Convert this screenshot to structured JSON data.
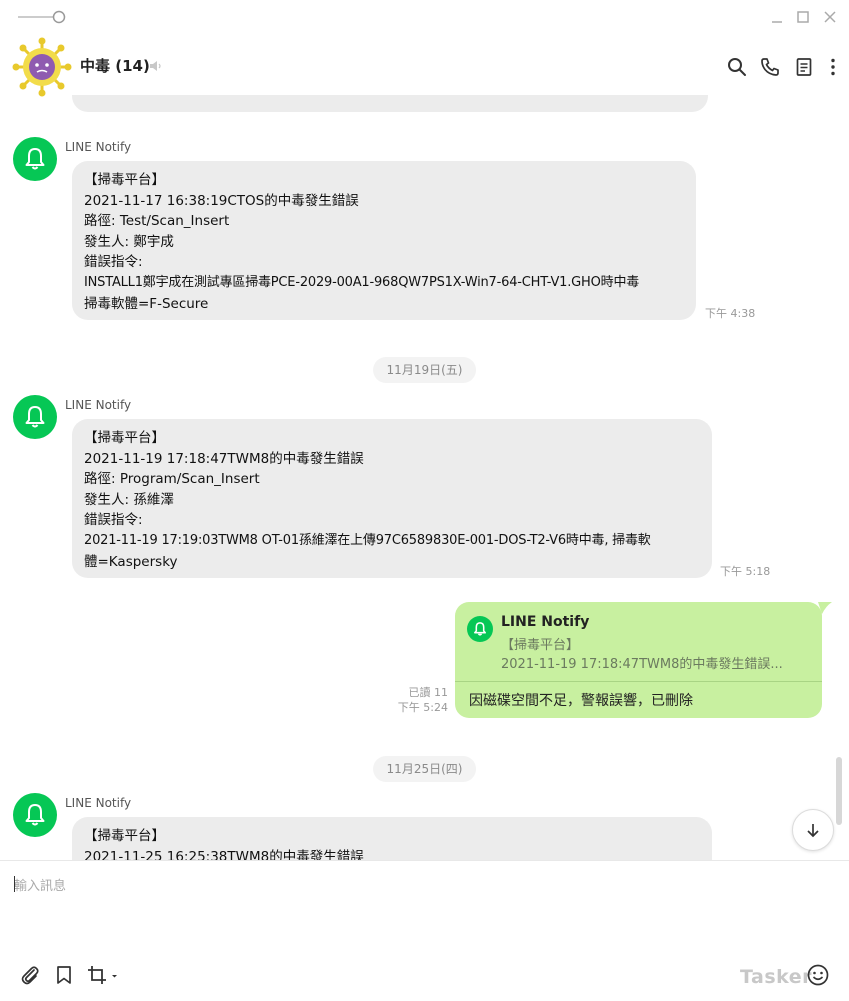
{
  "header": {
    "chat_name": "中毒",
    "member_count": "(14)"
  },
  "icons": {
    "slider": "slider-icon",
    "minimize": "minimize-icon",
    "maximize": "maximize-icon",
    "close": "close-icon",
    "search": "search-icon",
    "call": "phone-icon",
    "notes": "notes-icon",
    "more": "more-vertical-icon",
    "mute": "speaker-muted-icon",
    "attach": "paperclip-icon",
    "keep": "bookmark-icon",
    "screenshot": "crop-icon",
    "emoji": "emoji-icon",
    "scroll_down": "arrow-down-icon"
  },
  "colors": {
    "line_green": "#06c755",
    "my_bubble": "#c8f0a0",
    "other_bubble": "#ececec"
  },
  "messages": [
    {
      "sender": "LINE Notify",
      "lines": [
        "【掃毒平台】",
        "2021-11-17 16:38:19CTOS的中毒發生錯誤",
        "路徑: Test/Scan_Insert",
        "發生人: 鄭宇成",
        "錯誤指令:",
        "INSTALL1鄭宇成在測試專區掃毒PCE-2029-00A1-968QW7PS1X-Win7-64-CHT-V1.GHO時中毒",
        "掃毒軟體=F-Secure"
      ],
      "time": "下午 4:38"
    },
    {
      "sender": "LINE Notify",
      "lines": [
        "【掃毒平台】",
        "2021-11-19 17:18:47TWM8的中毒發生錯誤",
        "路徑: Program/Scan_Insert",
        "發生人: 孫維澤",
        "錯誤指令:",
        "2021-11-19 17:19:03TWM8 OT-01孫維澤在上傳97C6589830E-001-DOS-T2-V6時中毒, 掃毒軟",
        "體=Kaspersky"
      ],
      "time": "下午 5:18"
    },
    {
      "sender": "LINE Notify",
      "lines": [
        "【掃毒平台】",
        "2021-11-25 16:25:38TWM8的中毒發生錯誤"
      ],
      "time": ""
    }
  ],
  "dates": [
    "11月19日(五)",
    "11月25日(四)"
  ],
  "my_reply": {
    "quote_sender": "LINE Notify",
    "quote_line1": "【掃毒平台】",
    "quote_line2": "2021-11-19 17:18:47TWM8的中毒發生錯誤...",
    "text": "因磁碟空間不足，警報誤響，已刪除",
    "read": "已讀 11",
    "time": "下午 5:24"
  },
  "composer": {
    "placeholder": "輸入訊息"
  },
  "watermark": "Tasker"
}
